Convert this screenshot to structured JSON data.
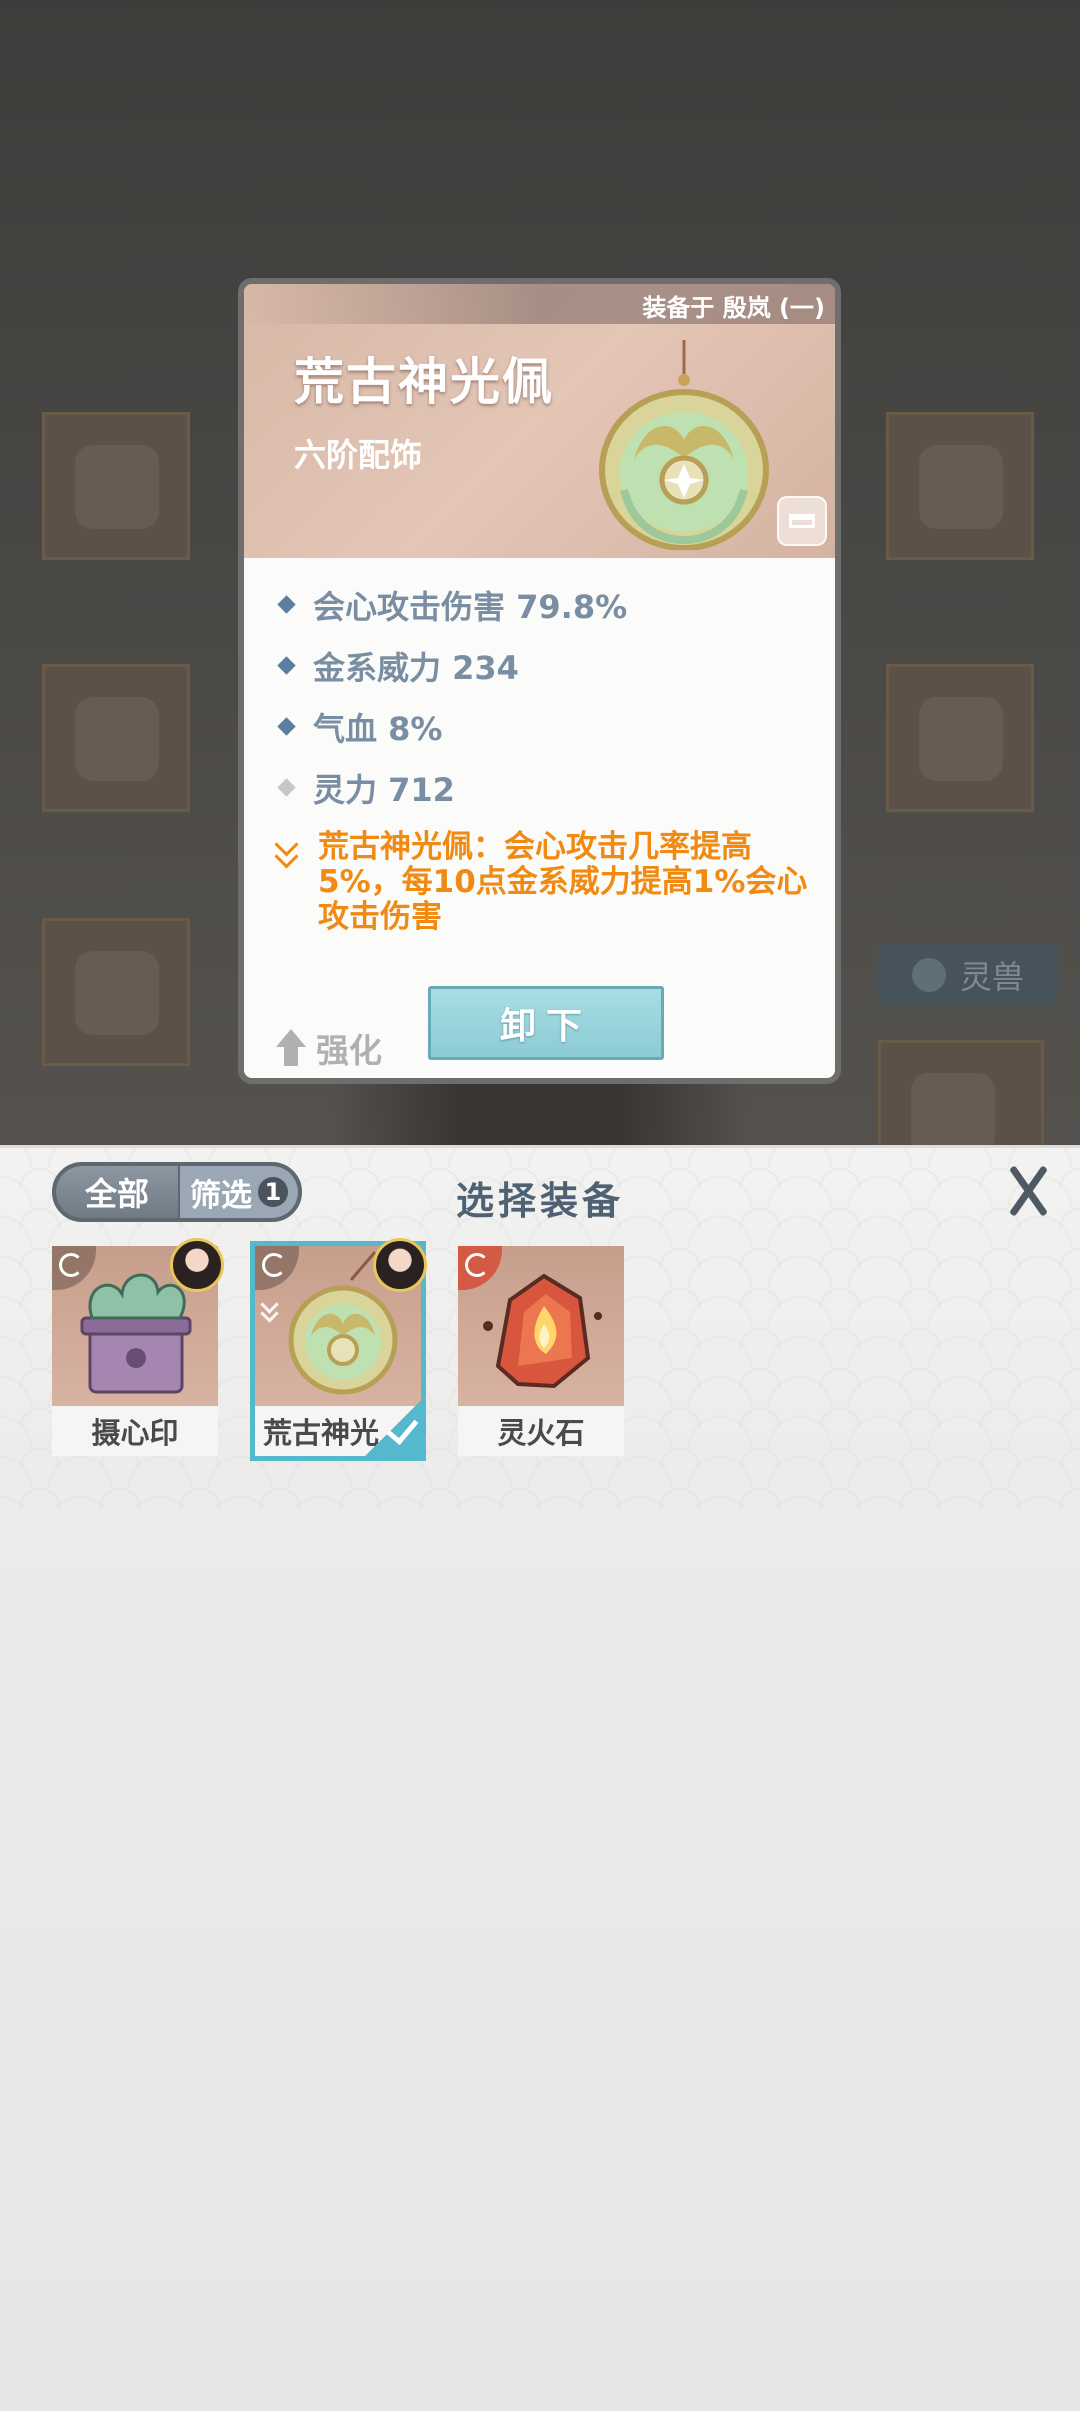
{
  "detail": {
    "equipped_on": "装备于 殷岚 (一)",
    "name": "荒古神光佩",
    "tier": "六阶配饰",
    "stats": [
      {
        "text": "会心攻击伤害 79.8%",
        "marker": "blue-diamond"
      },
      {
        "text": "金系威力 234",
        "marker": "blue-diamond"
      },
      {
        "text": "气血 8%",
        "marker": "blue-diamond"
      },
      {
        "text": "灵力 712",
        "marker": "gray-diamond"
      }
    ],
    "skill": "荒古神光佩：会心攻击几率提高5%，每10点金系威力提高1%会心攻击伤害",
    "enhance_label": "强化",
    "unequip_label": "卸下",
    "colors": {
      "skill": "#f08a13",
      "stat": "#7a8ea3",
      "accent": "#56b8cc"
    }
  },
  "background": {
    "beast_label": "灵兽"
  },
  "panel": {
    "title": "选择装备",
    "filter_all": "全部",
    "filter_label": "筛选",
    "filter_count": "1",
    "items": [
      {
        "name": "摄心印",
        "icon": "seal-box-icon",
        "selected": false
      },
      {
        "name": "荒古神光",
        "icon": "jade-pendant-icon",
        "selected": true
      },
      {
        "name": "灵火石",
        "icon": "fire-stone-icon",
        "selected": false
      }
    ]
  }
}
